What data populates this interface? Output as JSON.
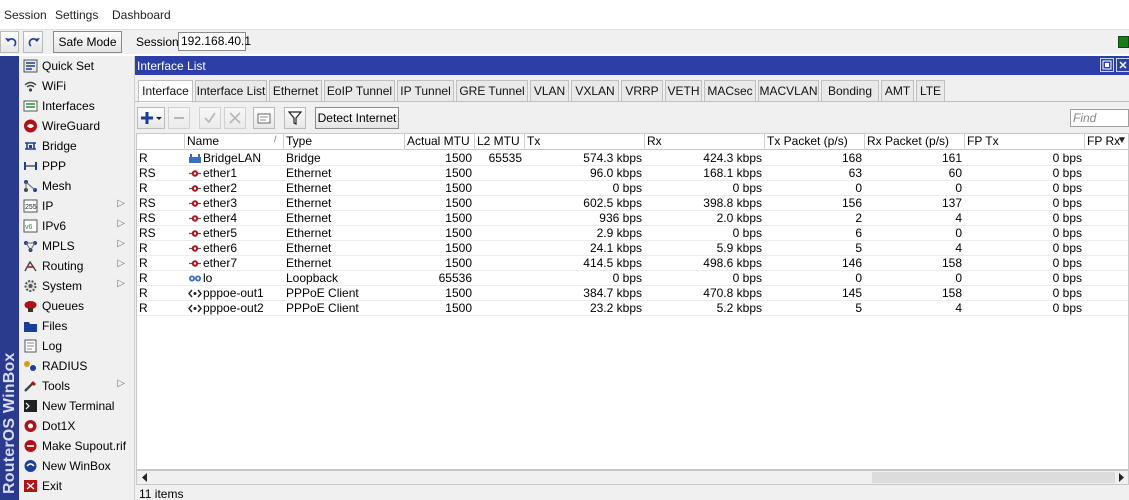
{
  "menu": {
    "session": "Session",
    "settings": "Settings",
    "dashboard": "Dashboard"
  },
  "toolbar": {
    "safe_mode": "Safe Mode",
    "session_label": "Session:",
    "session_value": "192.168.40.1"
  },
  "brand": "RouterOS WinBox",
  "sidebar": {
    "items": [
      {
        "label": "Quick Set",
        "icon": "quickset-icon",
        "submenu": false
      },
      {
        "label": "WiFi",
        "icon": "wifi-icon",
        "submenu": false
      },
      {
        "label": "Interfaces",
        "icon": "interfaces-icon",
        "submenu": false
      },
      {
        "label": "WireGuard",
        "icon": "wireguard-icon",
        "submenu": false
      },
      {
        "label": "Bridge",
        "icon": "bridge-icon",
        "submenu": false
      },
      {
        "label": "PPP",
        "icon": "ppp-icon",
        "submenu": false
      },
      {
        "label": "Mesh",
        "icon": "mesh-icon",
        "submenu": false
      },
      {
        "label": "IP",
        "icon": "ip-icon",
        "submenu": true
      },
      {
        "label": "IPv6",
        "icon": "ipv6-icon",
        "submenu": true
      },
      {
        "label": "MPLS",
        "icon": "mpls-icon",
        "submenu": true
      },
      {
        "label": "Routing",
        "icon": "routing-icon",
        "submenu": true
      },
      {
        "label": "System",
        "icon": "system-icon",
        "submenu": true
      },
      {
        "label": "Queues",
        "icon": "queues-icon",
        "submenu": false
      },
      {
        "label": "Files",
        "icon": "files-icon",
        "submenu": false
      },
      {
        "label": "Log",
        "icon": "log-icon",
        "submenu": false
      },
      {
        "label": "RADIUS",
        "icon": "radius-icon",
        "submenu": false
      },
      {
        "label": "Tools",
        "icon": "tools-icon",
        "submenu": true
      },
      {
        "label": "New Terminal",
        "icon": "terminal-icon",
        "submenu": false
      },
      {
        "label": "Dot1X",
        "icon": "dot1x-icon",
        "submenu": false
      },
      {
        "label": "Make Supout.rif",
        "icon": "supout-icon",
        "submenu": false
      },
      {
        "label": "New WinBox",
        "icon": "winbox-icon",
        "submenu": false
      },
      {
        "label": "Exit",
        "icon": "exit-icon",
        "submenu": false
      }
    ]
  },
  "window": {
    "title": "Interface List",
    "tabs": [
      "Interface",
      "Interface List",
      "Ethernet",
      "EoIP Tunnel",
      "IP Tunnel",
      "GRE Tunnel",
      "VLAN",
      "VXLAN",
      "VRRP",
      "VETH",
      "MACsec",
      "MACVLAN",
      "Bonding",
      "AMT",
      "LTE"
    ],
    "active_tab": "Interface",
    "detect_internet": "Detect Internet",
    "find_placeholder": "Find",
    "columns": [
      "",
      "Name",
      "Type",
      "Actual MTU",
      "L2 MTU",
      "Tx",
      "Rx",
      "Tx Packet (p/s)",
      "Rx Packet (p/s)",
      "FP Tx",
      "FP Rx"
    ],
    "rows": [
      {
        "flags": "R",
        "icon": "bridge",
        "name": "BridgeLAN",
        "type": "Bridge",
        "mtu": "1500",
        "l2mtu": "65535",
        "tx": "574.3 kbps",
        "rx": "424.3 kbps",
        "txp": "168",
        "rxp": "161",
        "fptx": "0 bps"
      },
      {
        "flags": "RS",
        "icon": "ether",
        "name": "ether1",
        "type": "Ethernet",
        "mtu": "1500",
        "l2mtu": "",
        "tx": "96.0 kbps",
        "rx": "168.1 kbps",
        "txp": "63",
        "rxp": "60",
        "fptx": "0 bps"
      },
      {
        "flags": "R",
        "icon": "ether",
        "name": "ether2",
        "type": "Ethernet",
        "mtu": "1500",
        "l2mtu": "",
        "tx": "0 bps",
        "rx": "0 bps",
        "txp": "0",
        "rxp": "0",
        "fptx": "0 bps"
      },
      {
        "flags": "RS",
        "icon": "ether",
        "name": "ether3",
        "type": "Ethernet",
        "mtu": "1500",
        "l2mtu": "",
        "tx": "602.5 kbps",
        "rx": "398.8 kbps",
        "txp": "156",
        "rxp": "137",
        "fptx": "0 bps"
      },
      {
        "flags": "RS",
        "icon": "ether",
        "name": "ether4",
        "type": "Ethernet",
        "mtu": "1500",
        "l2mtu": "",
        "tx": "936 bps",
        "rx": "2.0 kbps",
        "txp": "2",
        "rxp": "4",
        "fptx": "0 bps"
      },
      {
        "flags": "RS",
        "icon": "ether",
        "name": "ether5",
        "type": "Ethernet",
        "mtu": "1500",
        "l2mtu": "",
        "tx": "2.9 kbps",
        "rx": "0 bps",
        "txp": "6",
        "rxp": "0",
        "fptx": "0 bps"
      },
      {
        "flags": "R",
        "icon": "ether",
        "name": "ether6",
        "type": "Ethernet",
        "mtu": "1500",
        "l2mtu": "",
        "tx": "24.1 kbps",
        "rx": "5.9 kbps",
        "txp": "5",
        "rxp": "4",
        "fptx": "0 bps"
      },
      {
        "flags": "R",
        "icon": "ether",
        "name": "ether7",
        "type": "Ethernet",
        "mtu": "1500",
        "l2mtu": "",
        "tx": "414.5 kbps",
        "rx": "498.6 kbps",
        "txp": "146",
        "rxp": "158",
        "fptx": "0 bps"
      },
      {
        "flags": "R",
        "icon": "loopback",
        "name": "lo",
        "type": "Loopback",
        "mtu": "65536",
        "l2mtu": "",
        "tx": "0 bps",
        "rx": "0 bps",
        "txp": "0",
        "rxp": "0",
        "fptx": "0 bps"
      },
      {
        "flags": "R",
        "icon": "ppp",
        "name": "pppoe-out1",
        "type": "PPPoE Client",
        "mtu": "1500",
        "l2mtu": "",
        "tx": "384.7 kbps",
        "rx": "470.8 kbps",
        "txp": "145",
        "rxp": "158",
        "fptx": "0 bps"
      },
      {
        "flags": "R",
        "icon": "ppp",
        "name": "pppoe-out2",
        "type": "PPPoE Client",
        "mtu": "1500",
        "l2mtu": "",
        "tx": "23.2 kbps",
        "rx": "5.2 kbps",
        "txp": "5",
        "rxp": "4",
        "fptx": "0 bps"
      }
    ],
    "status": "11 items"
  }
}
